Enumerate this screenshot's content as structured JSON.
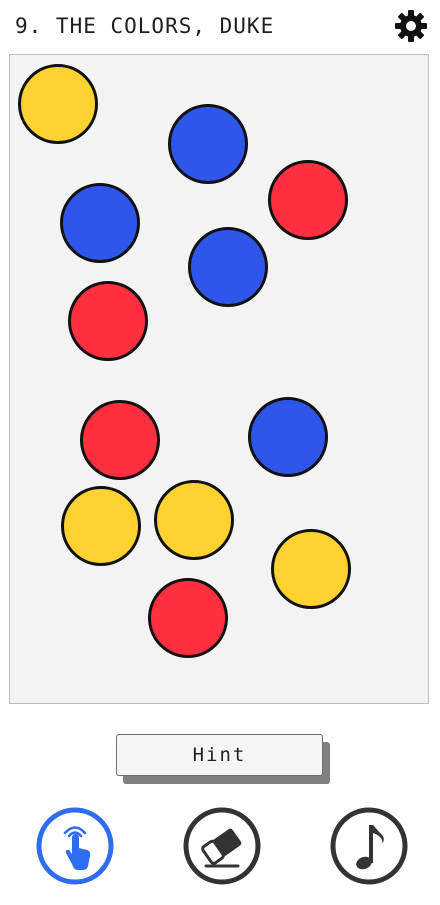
{
  "header": {
    "title": "9. The Colors, Duke",
    "settings_icon": "gear-icon"
  },
  "colors": {
    "yellow": "#fcd232",
    "blue": "#2e56ea",
    "red": "#fe2f3f",
    "active_tool": "#2e6cf0",
    "inactive_tool": "#333333"
  },
  "board": {
    "dots": [
      {
        "color": "yellow"
      },
      {
        "color": "blue"
      },
      {
        "color": "red"
      },
      {
        "color": "blue"
      },
      {
        "color": "blue"
      },
      {
        "color": "red"
      },
      {
        "color": "red"
      },
      {
        "color": "blue"
      },
      {
        "color": "yellow"
      },
      {
        "color": "yellow"
      },
      {
        "color": "yellow"
      },
      {
        "color": "red"
      }
    ]
  },
  "hint_button": {
    "label": "Hint"
  },
  "toolbar": {
    "tools": [
      {
        "name": "tap-tool",
        "icon": "tap-hand-icon",
        "active": true
      },
      {
        "name": "eraser-tool",
        "icon": "eraser-icon",
        "active": false
      },
      {
        "name": "music-toggle",
        "icon": "music-note-icon",
        "active": false
      }
    ]
  }
}
